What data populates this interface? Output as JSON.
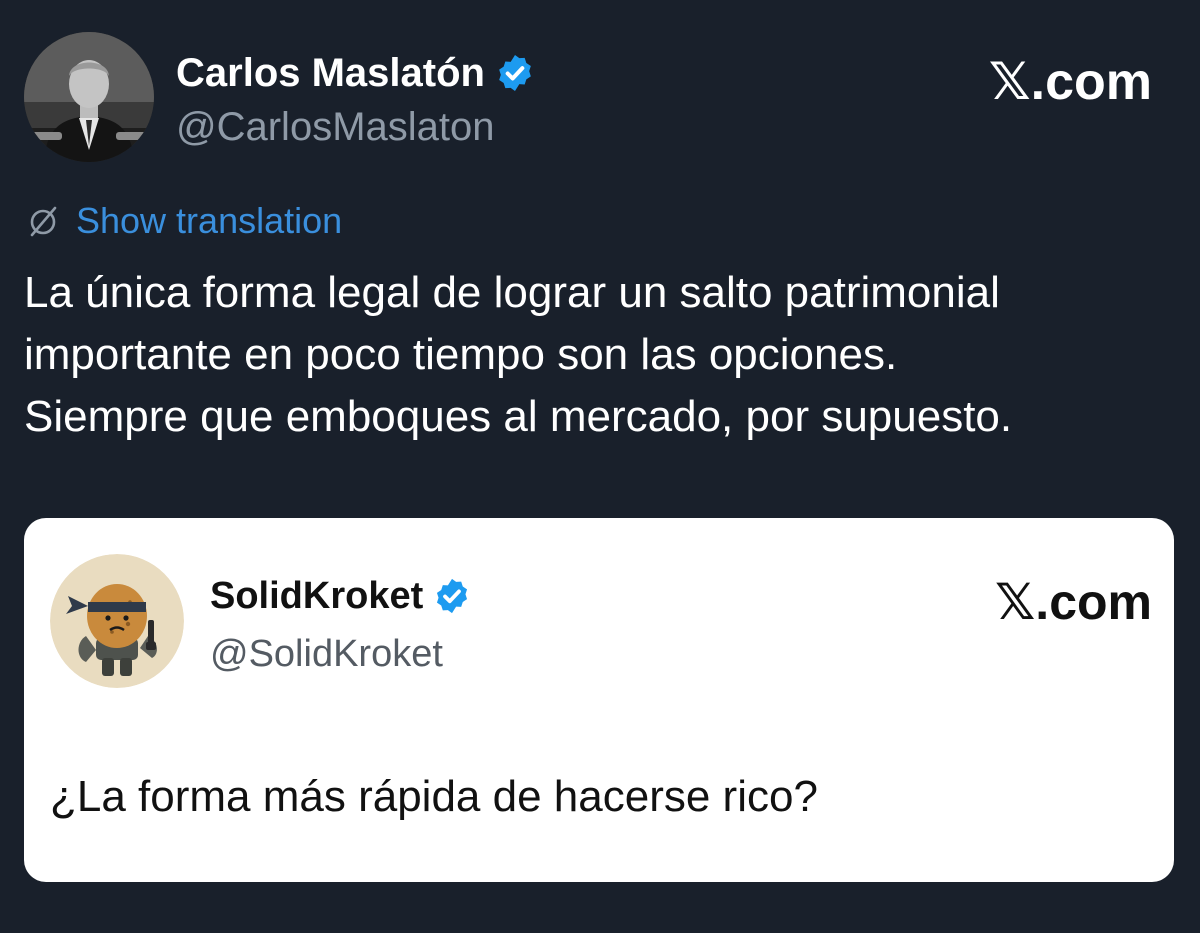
{
  "tweet": {
    "author": {
      "display_name": "Carlos Maslatón",
      "handle": "@CarlosMaslaton",
      "verified": true,
      "avatar_icon": "person-photo-avatar"
    },
    "site_label": "𝕏.com",
    "translation": {
      "icon": "globe-slash-icon",
      "label": "Show translation"
    },
    "body": {
      "lines": [
        "La única forma legal de lograr un salto patrimonial",
        "importante en poco tiempo son las opciones.",
        "Siempre que emboques al mercado, por supuesto."
      ]
    }
  },
  "quote": {
    "author": {
      "display_name": "SolidKroket",
      "handle": "@SolidKroket",
      "verified": true,
      "avatar_icon": "croquette-soldier-avatar"
    },
    "site_label": "𝕏.com",
    "text": "¿La forma más rápida de hacerse rico?"
  },
  "colors": {
    "background": "#19202b",
    "link_blue": "#3a8fdd",
    "verified_blue": "#1d9bf0",
    "quote_background": "#ffffff"
  }
}
